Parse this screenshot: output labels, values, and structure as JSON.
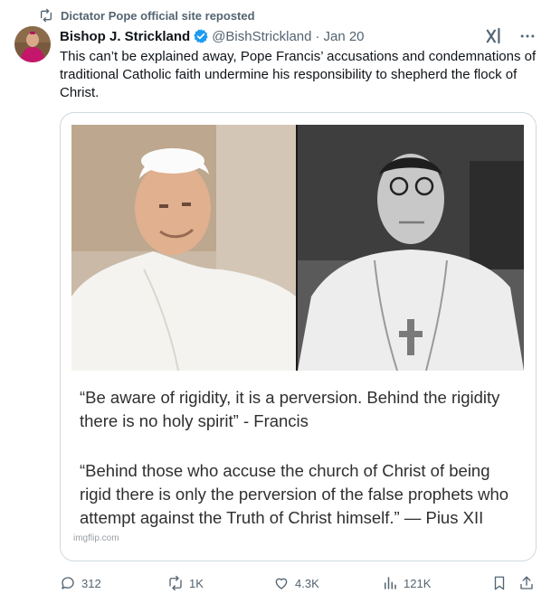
{
  "repost": {
    "label": "Dictator Pope official site reposted"
  },
  "tweet": {
    "author_name": "Bishop J. Strickland",
    "handle": "@BishStrickland",
    "separator": "·",
    "date": "Jan 20",
    "text": "This can’t be explained away, Pope Francis’ accusations and condemnations of traditional Catholic faith undermine his responsibility to shepherd the flock of Christ."
  },
  "media": {
    "quote_1": "“Be aware of rigidity, it is a perversion.  Behind the rigidity there is no holy spirit” - Francis",
    "quote_2": "“Behind those who accuse the church of Christ of being rigid there is only the perversion of the false prophets who attempt against the Truth of Christ himself.” — Pius XII",
    "watermark": "imgflip.com"
  },
  "actions": {
    "replies": "312",
    "reposts": "1K",
    "likes": "4.3K",
    "views": "121K"
  },
  "colors": {
    "verified": "#1d9bf0",
    "muted": "#536471",
    "border": "#cfd9de"
  }
}
